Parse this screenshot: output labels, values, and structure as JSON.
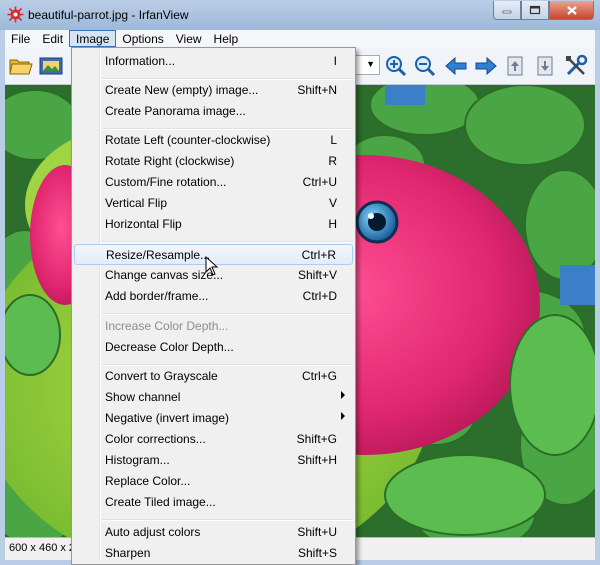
{
  "window": {
    "title": "beautiful-parrot.jpg - IrfanView"
  },
  "menubar": {
    "items": [
      {
        "label": "File"
      },
      {
        "label": "Edit"
      },
      {
        "label": "Image"
      },
      {
        "label": "Options"
      },
      {
        "label": "View"
      },
      {
        "label": "Help"
      }
    ],
    "open_menu": "Image"
  },
  "toolbar": {
    "icons": [
      "open-folder-icon",
      "slideshow-icon",
      "zoom-in-icon",
      "zoom-out-icon",
      "previous-arrow-icon",
      "next-arrow-icon",
      "page-up-icon",
      "page-down-icon",
      "tools-icon"
    ]
  },
  "image_menu": {
    "groups": [
      [
        {
          "label": "Information...",
          "key": "I"
        }
      ],
      [
        {
          "label": "Create New (empty) image...",
          "key": "Shift+N"
        },
        {
          "label": "Create Panorama image...",
          "key": ""
        }
      ],
      [
        {
          "label": "Rotate Left (counter-clockwise)",
          "key": "L"
        },
        {
          "label": "Rotate Right (clockwise)",
          "key": "R"
        },
        {
          "label": "Custom/Fine rotation...",
          "key": "Ctrl+U"
        },
        {
          "label": "Vertical Flip",
          "key": "V"
        },
        {
          "label": "Horizontal Flip",
          "key": "H"
        }
      ],
      [
        {
          "label": "Resize/Resample...",
          "key": "Ctrl+R"
        },
        {
          "label": "Change canvas size...",
          "key": "Shift+V"
        },
        {
          "label": "Add border/frame...",
          "key": "Ctrl+D"
        }
      ],
      [
        {
          "label": "Increase Color Depth...",
          "key": ""
        },
        {
          "label": "Decrease Color Depth...",
          "key": ""
        }
      ],
      [
        {
          "label": "Convert to Grayscale",
          "key": "Ctrl+G"
        },
        {
          "label": "Show channel",
          "key": ""
        },
        {
          "label": "Negative (invert image)",
          "key": ""
        },
        {
          "label": "Color corrections...",
          "key": "Shift+G"
        },
        {
          "label": "Histogram...",
          "key": "Shift+H"
        },
        {
          "label": "Replace Color...",
          "key": ""
        },
        {
          "label": "Create Tiled image...",
          "key": ""
        }
      ],
      [
        {
          "label": "Auto adjust colors",
          "key": "Shift+U"
        },
        {
          "label": "Sharpen",
          "key": "Shift+S"
        }
      ]
    ],
    "highlighted": "Resize/Resample...",
    "disabled": [
      "Increase Color Depth..."
    ],
    "submenus": [
      "Show channel",
      "Negative (invert image)"
    ]
  },
  "statusbar": {
    "text": "600 x 460 x 2"
  },
  "colors": {
    "titlebar": "#b9cde6",
    "menu_highlight": "#d5e3f5",
    "leaf_green": "#3e9b3a",
    "parrot_pink": "#e0266e"
  }
}
